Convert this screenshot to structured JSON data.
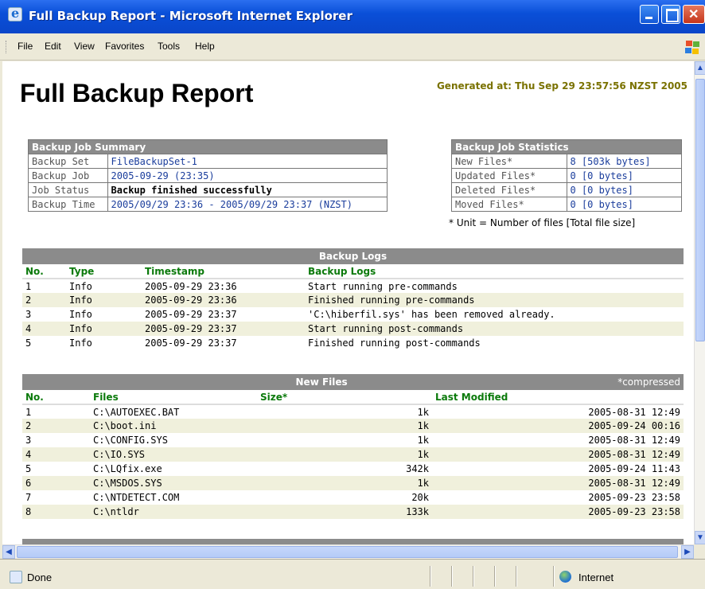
{
  "window": {
    "title": "Full Backup Report - Microsoft Internet Explorer"
  },
  "menu": {
    "items": [
      {
        "label": "File"
      },
      {
        "label": "Edit"
      },
      {
        "label": "View"
      },
      {
        "label": "Favorites"
      },
      {
        "label": "Tools"
      },
      {
        "label": "Help"
      }
    ]
  },
  "report": {
    "title": "Full Backup Report",
    "generated": "Generated at: Thu Sep 29 23:57:56 NZST 2005"
  },
  "summary": {
    "header": "Backup Job Summary",
    "rows": [
      {
        "key": "Backup Set",
        "value": "FileBackupSet-1"
      },
      {
        "key": "Backup Job",
        "value": "2005-09-29 (23:35)"
      },
      {
        "key": "Job Status",
        "value": "Backup finished successfully"
      },
      {
        "key": "Backup Time",
        "value": "2005/09/29 23:36 - 2005/09/29 23:37 (NZST)"
      }
    ]
  },
  "stats": {
    "header": "Backup Job Statistics",
    "rows": [
      {
        "key": "New Files*",
        "value": "8 [503k bytes]"
      },
      {
        "key": "Updated Files*",
        "value": "0 [0 bytes]"
      },
      {
        "key": "Deleted Files*",
        "value": "0 [0 bytes]"
      },
      {
        "key": "Moved Files*",
        "value": "0 [0 bytes]"
      }
    ],
    "note": "* Unit = Number of files [Total file size]"
  },
  "logs": {
    "header": "Backup Logs",
    "columns": [
      "No.",
      "Type",
      "Timestamp",
      "Backup Logs"
    ],
    "rows": [
      [
        "1",
        "Info",
        "2005-09-29 23:36",
        "Start running pre-commands"
      ],
      [
        "2",
        "Info",
        "2005-09-29 23:36",
        "Finished running pre-commands"
      ],
      [
        "3",
        "Info",
        "2005-09-29 23:37",
        "'C:\\hiberfil.sys' has been removed already."
      ],
      [
        "4",
        "Info",
        "2005-09-29 23:37",
        "Start running post-commands"
      ],
      [
        "5",
        "Info",
        "2005-09-29 23:37",
        "Finished running post-commands"
      ]
    ]
  },
  "new_files": {
    "header": "New Files",
    "compressed_note": "*compressed",
    "columns": [
      "No.",
      "Files",
      "Size*",
      "Last Modified"
    ],
    "rows": [
      [
        "1",
        "C:\\AUTOEXEC.BAT",
        "1k",
        "2005-08-31 12:49"
      ],
      [
        "2",
        "C:\\boot.ini",
        "1k",
        "2005-09-24 00:16"
      ],
      [
        "3",
        "C:\\CONFIG.SYS",
        "1k",
        "2005-08-31 12:49"
      ],
      [
        "4",
        "C:\\IO.SYS",
        "1k",
        "2005-08-31 12:49"
      ],
      [
        "5",
        "C:\\LQfix.exe",
        "342k",
        "2005-09-24 11:43"
      ],
      [
        "6",
        "C:\\MSDOS.SYS",
        "1k",
        "2005-08-31 12:49"
      ],
      [
        "7",
        "C:\\NTDETECT.COM",
        "20k",
        "2005-09-23 23:58"
      ],
      [
        "8",
        "C:\\ntldr",
        "133k",
        "2005-09-23 23:58"
      ]
    ]
  },
  "status": {
    "text": "Done",
    "zone": "Internet"
  }
}
